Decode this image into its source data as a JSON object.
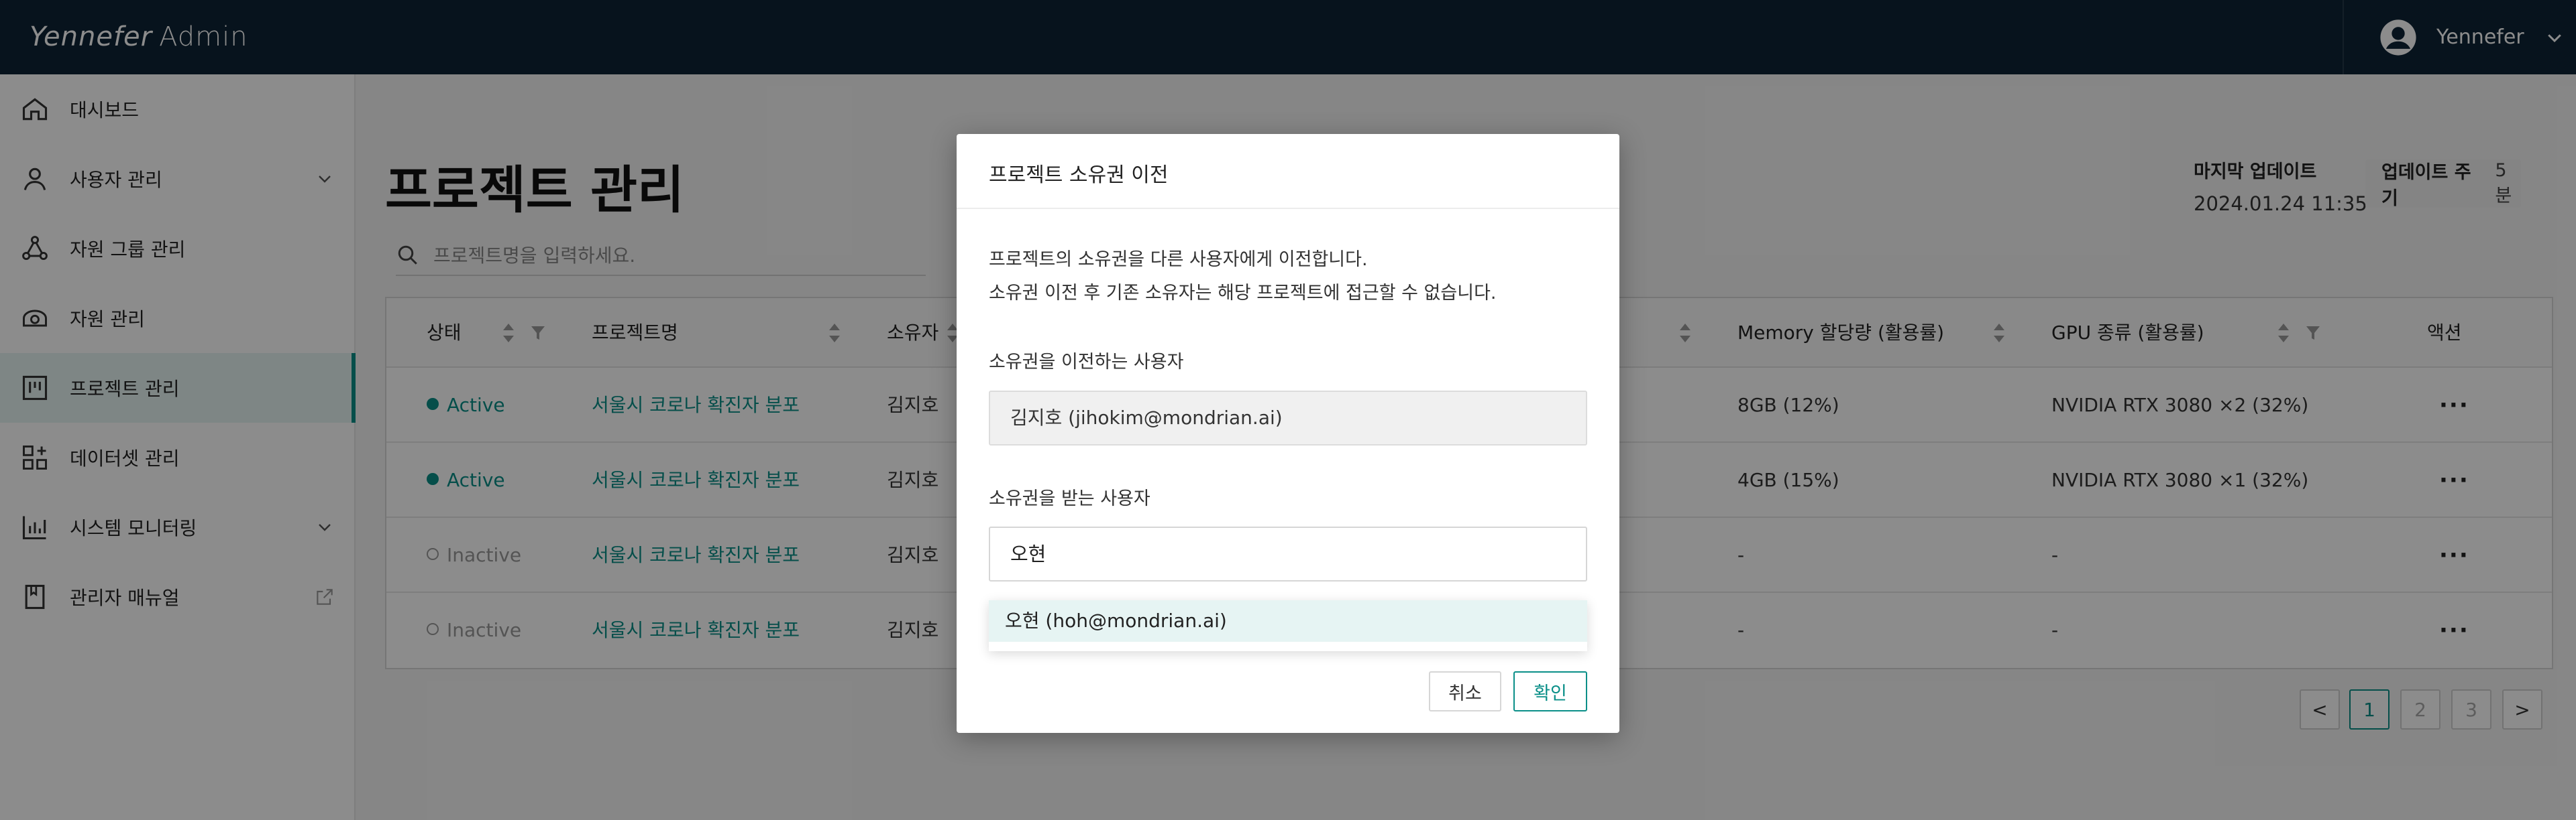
{
  "app": {
    "brand": "Yennefer",
    "suffix": "Admin"
  },
  "user": {
    "name": "Yennefer"
  },
  "sidebar": {
    "items": [
      {
        "label": "대시보드"
      },
      {
        "label": "사용자 관리"
      },
      {
        "label": "자원 그룹 관리"
      },
      {
        "label": "자원 관리"
      },
      {
        "label": "프로젝트 관리"
      },
      {
        "label": "데이터셋 관리"
      },
      {
        "label": "시스템 모니터링"
      },
      {
        "label": "관리자 매뉴얼"
      }
    ]
  },
  "main": {
    "title": "프로젝트 관리",
    "search_placeholder": "프로젝트명을 입력하세요.",
    "update_label": "마지막 업데이트",
    "update_time": "2024.01.24 11:35",
    "cycle_label": "업데이트 주기",
    "cycle_value": "5분"
  },
  "table": {
    "headers": [
      "상태",
      "프로젝트명",
      "소유자",
      "Memory 할당량 (활용률)",
      "GPU 종류 (활용률)",
      "액션"
    ],
    "rows": [
      {
        "status": "Active",
        "name": "서울시 코로나 확진자 분포",
        "owner": "김지호",
        "memory": "8GB (12%)",
        "gpu": "NVIDIA RTX 3080 ×2 (32%)",
        "action": "···"
      },
      {
        "status": "Active",
        "name": "서울시 코로나 확진자 분포",
        "owner": "김지호",
        "memory": "4GB (15%)",
        "gpu": "NVIDIA RTX 3080 ×1 (32%)",
        "action": "···"
      },
      {
        "status": "Inactive",
        "name": "서울시 코로나 확진자 분포",
        "owner": "김지호",
        "memory": "-",
        "gpu": "-",
        "action": "···"
      },
      {
        "status": "Inactive",
        "name": "서울시 코로나 확진자 분포",
        "owner": "김지호",
        "memory": "-",
        "gpu": "-",
        "action": "···"
      }
    ]
  },
  "pagination": {
    "prev": "<",
    "pages": [
      "1",
      "2",
      "3"
    ],
    "current": "1",
    "next": ">"
  },
  "modal": {
    "title": "프로젝트 소유권 이전",
    "desc_line1": "프로젝트의 소유권을 다른 사용자에게 이전합니다.",
    "desc_line2": "소유권 이전 후 기존 소유자는 해당 프로젝트에 접근할 수 없습니다.",
    "from_label": "소유권을 이전하는 사용자",
    "from_value": "김지호 (jihokim@mondrian.ai)",
    "to_label": "소유권을 받는 사용자",
    "to_value": "오현",
    "suggestion": "오현 (hoh@mondrian.ai)",
    "cancel": "취소",
    "confirm": "확인"
  },
  "colors": {
    "header": "#0e2435",
    "accent": "#0a8f88"
  }
}
